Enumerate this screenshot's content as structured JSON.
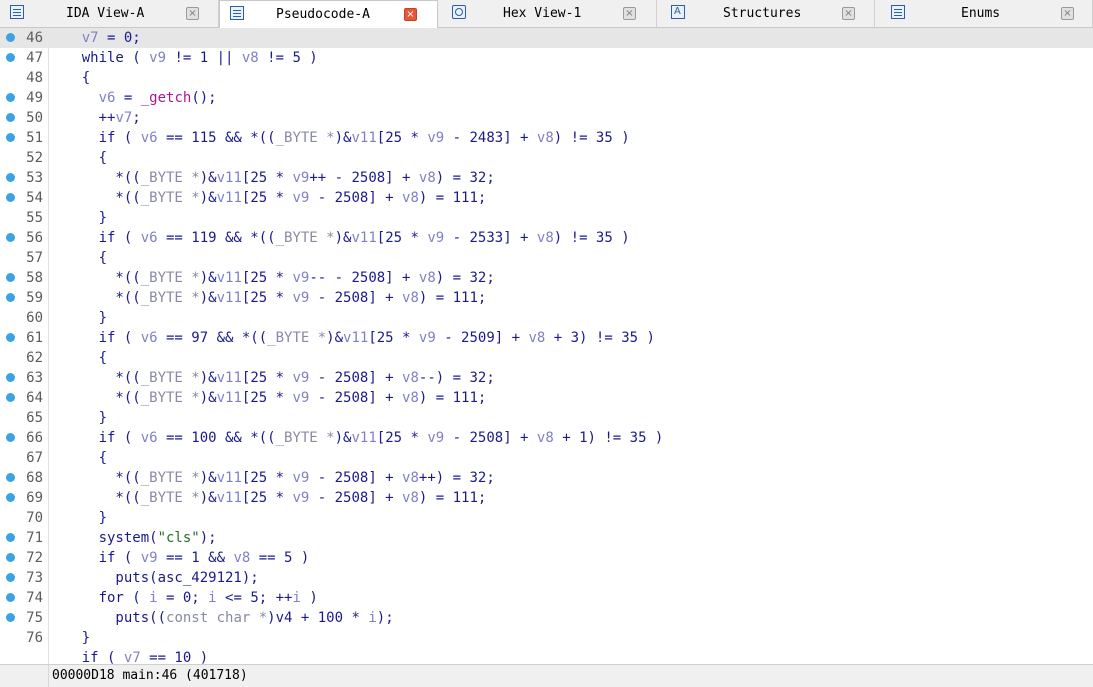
{
  "tabs": [
    {
      "label": "IDA View-A",
      "icon": "ida-view-icon",
      "active": false
    },
    {
      "label": "Pseudocode-A",
      "icon": "pseudocode-icon",
      "active": true
    },
    {
      "label": "Hex View-1",
      "icon": "hex-view-icon",
      "active": false
    },
    {
      "label": "Structures",
      "icon": "structures-icon",
      "active": false
    },
    {
      "label": "Enums",
      "icon": "enums-icon",
      "active": false
    }
  ],
  "close_glyph": "×",
  "code": {
    "current_line": "46",
    "lines": [
      {
        "num": "46",
        "bp": true,
        "segs": [
          [
            "",
            "    "
          ],
          [
            "v",
            "v7"
          ],
          [
            "",
            " = 0;"
          ]
        ]
      },
      {
        "num": "47",
        "bp": true,
        "segs": [
          [
            "",
            "    while ( "
          ],
          [
            "v",
            "v9"
          ],
          [
            "",
            " != 1 || "
          ],
          [
            "v",
            "v8"
          ],
          [
            "",
            " != 5 )"
          ]
        ]
      },
      {
        "num": "48",
        "bp": false,
        "segs": [
          [
            "",
            "    {"
          ]
        ]
      },
      {
        "num": "49",
        "bp": true,
        "segs": [
          [
            "",
            "      "
          ],
          [
            "v",
            "v6"
          ],
          [
            "",
            " = "
          ],
          [
            "f",
            "_getch"
          ],
          [
            "",
            "();"
          ]
        ]
      },
      {
        "num": "50",
        "bp": true,
        "segs": [
          [
            "",
            "      ++"
          ],
          [
            "v",
            "v7"
          ],
          [
            "",
            ";"
          ]
        ]
      },
      {
        "num": "51",
        "bp": true,
        "segs": [
          [
            "",
            "      if ( "
          ],
          [
            "v",
            "v6"
          ],
          [
            "",
            " == 115 && *(("
          ],
          [
            "t",
            "_BYTE *"
          ],
          [
            "",
            ")&"
          ],
          [
            "v",
            "v11"
          ],
          [
            "",
            "[25 * "
          ],
          [
            "v",
            "v9"
          ],
          [
            "",
            " - 2483] + "
          ],
          [
            "v",
            "v8"
          ],
          [
            "",
            ") != 35 )"
          ]
        ]
      },
      {
        "num": "52",
        "bp": false,
        "segs": [
          [
            "",
            "      {"
          ]
        ]
      },
      {
        "num": "53",
        "bp": true,
        "segs": [
          [
            "",
            "        *(("
          ],
          [
            "t",
            "_BYTE *"
          ],
          [
            "",
            ")&"
          ],
          [
            "v",
            "v11"
          ],
          [
            "",
            "[25 * "
          ],
          [
            "v",
            "v9"
          ],
          [
            "",
            "++ - 2508] + "
          ],
          [
            "v",
            "v8"
          ],
          [
            "",
            ") = 32;"
          ]
        ]
      },
      {
        "num": "54",
        "bp": true,
        "segs": [
          [
            "",
            "        *(("
          ],
          [
            "t",
            "_BYTE *"
          ],
          [
            "",
            ")&"
          ],
          [
            "v",
            "v11"
          ],
          [
            "",
            "[25 * "
          ],
          [
            "v",
            "v9"
          ],
          [
            "",
            " - 2508] + "
          ],
          [
            "v",
            "v8"
          ],
          [
            "",
            ") = 111;"
          ]
        ]
      },
      {
        "num": "55",
        "bp": false,
        "segs": [
          [
            "",
            "      }"
          ]
        ]
      },
      {
        "num": "56",
        "bp": true,
        "segs": [
          [
            "",
            "      if ( "
          ],
          [
            "v",
            "v6"
          ],
          [
            "",
            " == 119 && *(("
          ],
          [
            "t",
            "_BYTE *"
          ],
          [
            "",
            ")&"
          ],
          [
            "v",
            "v11"
          ],
          [
            "",
            "[25 * "
          ],
          [
            "v",
            "v9"
          ],
          [
            "",
            " - 2533] + "
          ],
          [
            "v",
            "v8"
          ],
          [
            "",
            ") != 35 )"
          ]
        ]
      },
      {
        "num": "57",
        "bp": false,
        "segs": [
          [
            "",
            "      {"
          ]
        ]
      },
      {
        "num": "58",
        "bp": true,
        "segs": [
          [
            "",
            "        *(("
          ],
          [
            "t",
            "_BYTE *"
          ],
          [
            "",
            ")&"
          ],
          [
            "v",
            "v11"
          ],
          [
            "",
            "[25 * "
          ],
          [
            "v",
            "v9"
          ],
          [
            "",
            "-- - 2508] + "
          ],
          [
            "v",
            "v8"
          ],
          [
            "",
            ") = 32;"
          ]
        ]
      },
      {
        "num": "59",
        "bp": true,
        "segs": [
          [
            "",
            "        *(("
          ],
          [
            "t",
            "_BYTE *"
          ],
          [
            "",
            ")&"
          ],
          [
            "v",
            "v11"
          ],
          [
            "",
            "[25 * "
          ],
          [
            "v",
            "v9"
          ],
          [
            "",
            " - 2508] + "
          ],
          [
            "v",
            "v8"
          ],
          [
            "",
            ") = 111;"
          ]
        ]
      },
      {
        "num": "60",
        "bp": false,
        "segs": [
          [
            "",
            "      }"
          ]
        ]
      },
      {
        "num": "61",
        "bp": true,
        "segs": [
          [
            "",
            "      if ( "
          ],
          [
            "v",
            "v6"
          ],
          [
            "",
            " == 97 && *(("
          ],
          [
            "t",
            "_BYTE *"
          ],
          [
            "",
            ")&"
          ],
          [
            "v",
            "v11"
          ],
          [
            "",
            "[25 * "
          ],
          [
            "v",
            "v9"
          ],
          [
            "",
            " - 2509] + "
          ],
          [
            "v",
            "v8"
          ],
          [
            "",
            " + 3) != 35 )"
          ]
        ]
      },
      {
        "num": "62",
        "bp": false,
        "segs": [
          [
            "",
            "      {"
          ]
        ]
      },
      {
        "num": "63",
        "bp": true,
        "segs": [
          [
            "",
            "        *(("
          ],
          [
            "t",
            "_BYTE *"
          ],
          [
            "",
            ")&"
          ],
          [
            "v",
            "v11"
          ],
          [
            "",
            "[25 * "
          ],
          [
            "v",
            "v9"
          ],
          [
            "",
            " - 2508] + "
          ],
          [
            "v",
            "v8"
          ],
          [
            "",
            "--) = 32;"
          ]
        ]
      },
      {
        "num": "64",
        "bp": true,
        "segs": [
          [
            "",
            "        *(("
          ],
          [
            "t",
            "_BYTE *"
          ],
          [
            "",
            ")&"
          ],
          [
            "v",
            "v11"
          ],
          [
            "",
            "[25 * "
          ],
          [
            "v",
            "v9"
          ],
          [
            "",
            " - 2508] + "
          ],
          [
            "v",
            "v8"
          ],
          [
            "",
            ") = 111;"
          ]
        ]
      },
      {
        "num": "65",
        "bp": false,
        "segs": [
          [
            "",
            "      }"
          ]
        ]
      },
      {
        "num": "66",
        "bp": true,
        "segs": [
          [
            "",
            "      if ( "
          ],
          [
            "v",
            "v6"
          ],
          [
            "",
            " == 100 && *(("
          ],
          [
            "t",
            "_BYTE *"
          ],
          [
            "",
            ")&"
          ],
          [
            "v",
            "v11"
          ],
          [
            "",
            "[25 * "
          ],
          [
            "v",
            "v9"
          ],
          [
            "",
            " - 2508] + "
          ],
          [
            "v",
            "v8"
          ],
          [
            "",
            " + 1) != 35 )"
          ]
        ]
      },
      {
        "num": "67",
        "bp": false,
        "segs": [
          [
            "",
            "      {"
          ]
        ]
      },
      {
        "num": "68",
        "bp": true,
        "segs": [
          [
            "",
            "        *(("
          ],
          [
            "t",
            "_BYTE *"
          ],
          [
            "",
            ")&"
          ],
          [
            "v",
            "v11"
          ],
          [
            "",
            "[25 * "
          ],
          [
            "v",
            "v9"
          ],
          [
            "",
            " - 2508] + "
          ],
          [
            "v",
            "v8"
          ],
          [
            "",
            "++) = 32;"
          ]
        ]
      },
      {
        "num": "69",
        "bp": true,
        "segs": [
          [
            "",
            "        *(("
          ],
          [
            "t",
            "_BYTE *"
          ],
          [
            "",
            ")&"
          ],
          [
            "v",
            "v11"
          ],
          [
            "",
            "[25 * "
          ],
          [
            "v",
            "v9"
          ],
          [
            "",
            " - 2508] + "
          ],
          [
            "v",
            "v8"
          ],
          [
            "",
            ") = 111;"
          ]
        ]
      },
      {
        "num": "70",
        "bp": false,
        "segs": [
          [
            "",
            "      }"
          ]
        ]
      },
      {
        "num": "71",
        "bp": true,
        "segs": [
          [
            "",
            "      system("
          ],
          [
            "s",
            "\"cls\""
          ],
          [
            "",
            ");"
          ]
        ]
      },
      {
        "num": "72",
        "bp": true,
        "segs": [
          [
            "",
            "      if ( "
          ],
          [
            "v",
            "v9"
          ],
          [
            "",
            " == 1 && "
          ],
          [
            "v",
            "v8"
          ],
          [
            "",
            " == 5 )"
          ]
        ]
      },
      {
        "num": "73",
        "bp": true,
        "segs": [
          [
            "",
            "        puts(asc_429121);"
          ]
        ]
      },
      {
        "num": "74",
        "bp": true,
        "segs": [
          [
            "",
            "      for ( "
          ],
          [
            "v",
            "i"
          ],
          [
            "",
            " = 0; "
          ],
          [
            "v",
            "i"
          ],
          [
            "",
            " <= 5; ++"
          ],
          [
            "v",
            "i"
          ],
          [
            "",
            " )"
          ]
        ]
      },
      {
        "num": "75",
        "bp": true,
        "segs": [
          [
            "",
            "        puts(("
          ],
          [
            "t",
            "const char *"
          ],
          [
            "",
            ")v4 + 100 * "
          ],
          [
            "v",
            "i"
          ],
          [
            "",
            ");"
          ]
        ]
      },
      {
        "num": "76",
        "bp": false,
        "segs": [
          [
            "",
            "    }"
          ]
        ]
      },
      {
        "num": "",
        "bp": false,
        "segs": [
          [
            "",
            "    if ( "
          ],
          [
            "v",
            "v7"
          ],
          [
            "",
            " == 10 )"
          ]
        ]
      }
    ]
  },
  "status": {
    "text": "00000D18 main:46 (401718)"
  },
  "colors": {
    "breakpoint": "#3aa3e6",
    "keyword": "#1a1a8c",
    "variable": "#8080c8",
    "type": "#888aa6",
    "string": "#207020",
    "function": "#b0148c",
    "current_line_bg": "#e6e6e6",
    "active_close": "#e8563a"
  }
}
